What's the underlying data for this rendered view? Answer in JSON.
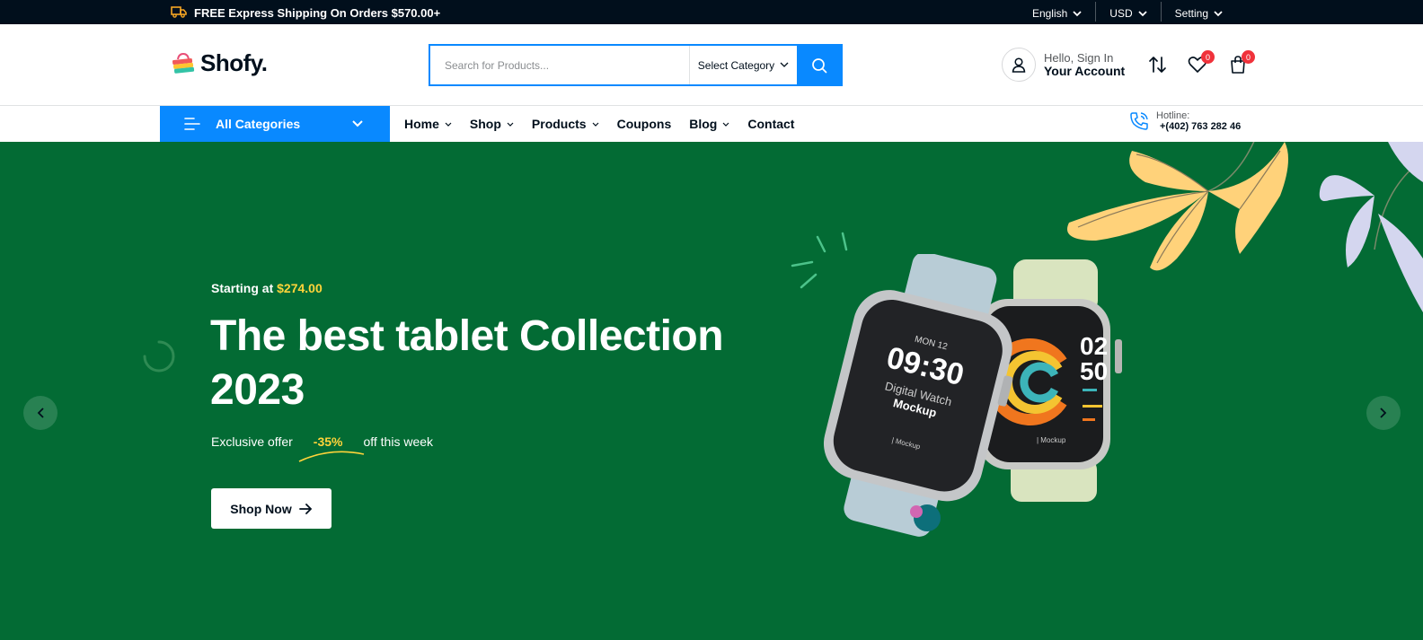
{
  "topbar": {
    "shipping_text": "FREE Express Shipping On Orders $570.00+",
    "language": "English",
    "currency": "USD",
    "setting": "Setting"
  },
  "header": {
    "logo": "Shofy.",
    "search_placeholder": "Search for Products...",
    "category_select": "Select Category",
    "account_greeting": "Hello, Sign In",
    "account_label": "Your Account",
    "wishlist_count": "0",
    "cart_count": "0"
  },
  "nav": {
    "all_categories": "All Categories",
    "items": [
      {
        "label": "Home",
        "has_dropdown": true
      },
      {
        "label": "Shop",
        "has_dropdown": true
      },
      {
        "label": "Products",
        "has_dropdown": true
      },
      {
        "label": "Coupons",
        "has_dropdown": false
      },
      {
        "label": "Blog",
        "has_dropdown": true
      },
      {
        "label": "Contact",
        "has_dropdown": false
      }
    ],
    "hotline_label": "Hotline:",
    "hotline_number": "+(402) 763 282 46"
  },
  "hero": {
    "starting_label": "Starting at",
    "price": "$274.00",
    "title": "The best tablet Collection 2023",
    "offer_prefix": "Exclusive offer",
    "offer_percent": "-35%",
    "offer_suffix": "off this week",
    "cta": "Shop Now",
    "watch1": {
      "date": "MON 12",
      "time": "09:30",
      "line1": "Digital Watch",
      "line2": "Mockup",
      "brand": "| Mockup"
    },
    "watch2": {
      "hour": "02",
      "minute": "50",
      "brand": "| Mockup"
    }
  },
  "colors": {
    "primary": "#0989ff",
    "hero_bg": "#036b34",
    "accent_yellow": "#ffd43a",
    "dark": "#010f1c",
    "badge_red": "#f0323b"
  }
}
